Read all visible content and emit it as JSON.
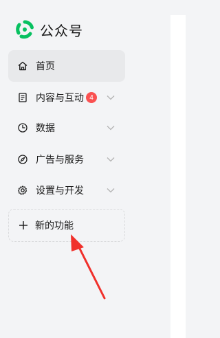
{
  "app": {
    "title": "公众号"
  },
  "sidebar": {
    "items": [
      {
        "label": "首页",
        "icon": "home-icon",
        "active": true
      },
      {
        "label": "内容与互动",
        "icon": "document-icon",
        "badge": "4",
        "expandable": true
      },
      {
        "label": "数据",
        "icon": "pie-chart-icon",
        "expandable": true
      },
      {
        "label": "广告与服务",
        "icon": "compass-icon",
        "expandable": true
      },
      {
        "label": "设置与开发",
        "icon": "gear-icon",
        "expandable": true
      }
    ],
    "new_feature": {
      "label": "新的功能",
      "icon": "plus-icon"
    }
  },
  "colors": {
    "brand_green": "#07c160",
    "badge_red": "#fa5151",
    "annotation_red": "#f0302b",
    "active_bg": "#e8e9eb"
  }
}
